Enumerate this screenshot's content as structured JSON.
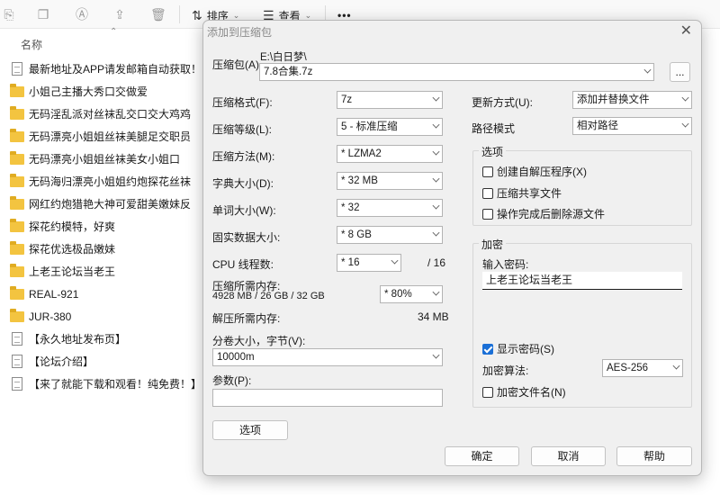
{
  "toolbar": {
    "sort_label": "排序",
    "view_label": "查看",
    "more_label": "•••"
  },
  "explorer": {
    "column_name": "名称",
    "files": [
      {
        "name": "最新地址及APP请发邮箱自动获取！！！",
        "icon": "text-file-icon"
      },
      {
        "name": "小姐己主播大秀口交做爱",
        "icon": "folder-icon"
      },
      {
        "name": "无码淫乱派对丝袜乱交口交大鸡鸡",
        "icon": "folder-icon"
      },
      {
        "name": "无码漂亮小姐姐丝袜美腿足交职员",
        "icon": "folder-icon"
      },
      {
        "name": "无码漂亮小姐姐丝袜美女小姐口",
        "icon": "folder-icon"
      },
      {
        "name": "无码海归漂亮小姐姐约炮探花丝袜",
        "icon": "folder-icon"
      },
      {
        "name": "网红约炮猎艳大神可爱甜美嫩妹反",
        "icon": "folder-icon"
      },
      {
        "name": "探花约模特，好爽",
        "icon": "folder-icon"
      },
      {
        "name": "探花优选极品嫩妹",
        "icon": "folder-icon"
      },
      {
        "name": "上老王论坛当老王",
        "icon": "folder-icon"
      },
      {
        "name": "REAL-921",
        "icon": "folder-icon"
      },
      {
        "name": "JUR-380",
        "icon": "folder-icon"
      },
      {
        "name": "【永久地址发布页】",
        "icon": "text-file-icon"
      },
      {
        "name": "【论坛介绍】",
        "icon": "text-file-icon"
      },
      {
        "name": "【来了就能下载和观看！纯免费！】",
        "icon": "text-file-icon"
      }
    ]
  },
  "dialog": {
    "title": "添加到压缩包",
    "archive_label": "压缩包(A)",
    "archive_path": "E:\\白日梦\\",
    "archive_name": "7.8合集.7z",
    "browse_label": "...",
    "format_label": "压缩格式(F):",
    "format_value": "7z",
    "level_label": "压缩等级(L):",
    "level_value": "5 - 标准压缩",
    "method_label": "压缩方法(M):",
    "method_value": "*  LZMA2",
    "dict_label": "字典大小(D):",
    "dict_value": "*  32 MB",
    "word_label": "单词大小(W):",
    "word_value": "*  32",
    "solid_label": "固实数据大小:",
    "solid_value": "*  8 GB",
    "cpu_label": "CPU 线程数:",
    "cpu_value": "*  16",
    "cpu_total": "/ 16",
    "mem_comp_label": "压缩所需内存:",
    "mem_comp_value": "4928 MB / 26 GB / 32 GB",
    "mem_percent": "*  80%",
    "mem_decomp_label": "解压所需内存:",
    "mem_decomp_value": "34 MB",
    "volume_label": "分卷大小，字节(V):",
    "volume_value": "10000m",
    "params_label": "参数(P):",
    "params_value": "",
    "options_button": "选项",
    "update_label": "更新方式(U):",
    "update_value": "添加并替换文件",
    "path_label": "路径模式",
    "path_value": "相对路径",
    "options_group": "选项",
    "opt_sfx": "创建自解压程序(X)",
    "opt_shared": "压缩共享文件",
    "opt_delete": "操作完成后删除源文件",
    "enc_group": "加密",
    "pw_label": "输入密码:",
    "pw_value": "上老王论坛当老王",
    "show_pw": "显示密码(S)",
    "enc_method_label": "加密算法:",
    "enc_method_value": "AES-256",
    "enc_names": "加密文件名(N)",
    "ok": "确定",
    "cancel": "取消",
    "help": "帮助"
  }
}
